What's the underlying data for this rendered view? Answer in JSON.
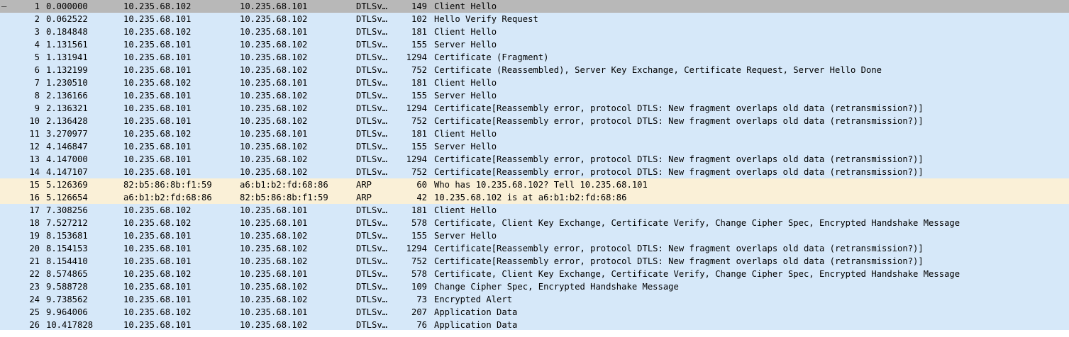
{
  "packets": [
    {
      "no": "1",
      "time": "0.000000",
      "src": "10.235.68.102",
      "dst": "10.235.68.101",
      "proto": "DTLSv…",
      "len": "149",
      "info": "Client Hello",
      "kind": "dtls",
      "selected": true,
      "marker": "–"
    },
    {
      "no": "2",
      "time": "0.062522",
      "src": "10.235.68.101",
      "dst": "10.235.68.102",
      "proto": "DTLSv…",
      "len": "102",
      "info": "Hello Verify Request",
      "kind": "dtls"
    },
    {
      "no": "3",
      "time": "0.184848",
      "src": "10.235.68.102",
      "dst": "10.235.68.101",
      "proto": "DTLSv…",
      "len": "181",
      "info": "Client Hello",
      "kind": "dtls"
    },
    {
      "no": "4",
      "time": "1.131561",
      "src": "10.235.68.101",
      "dst": "10.235.68.102",
      "proto": "DTLSv…",
      "len": "155",
      "info": "Server Hello",
      "kind": "dtls"
    },
    {
      "no": "5",
      "time": "1.131941",
      "src": "10.235.68.101",
      "dst": "10.235.68.102",
      "proto": "DTLSv…",
      "len": "1294",
      "info": "Certificate (Fragment)",
      "kind": "dtls"
    },
    {
      "no": "6",
      "time": "1.132199",
      "src": "10.235.68.101",
      "dst": "10.235.68.102",
      "proto": "DTLSv…",
      "len": "752",
      "info": "Certificate (Reassembled), Server Key Exchange, Certificate Request, Server Hello Done",
      "kind": "dtls"
    },
    {
      "no": "7",
      "time": "1.230510",
      "src": "10.235.68.102",
      "dst": "10.235.68.101",
      "proto": "DTLSv…",
      "len": "181",
      "info": "Client Hello",
      "kind": "dtls"
    },
    {
      "no": "8",
      "time": "2.136166",
      "src": "10.235.68.101",
      "dst": "10.235.68.102",
      "proto": "DTLSv…",
      "len": "155",
      "info": "Server Hello",
      "kind": "dtls"
    },
    {
      "no": "9",
      "time": "2.136321",
      "src": "10.235.68.101",
      "dst": "10.235.68.102",
      "proto": "DTLSv…",
      "len": "1294",
      "info": "Certificate[Reassembly error, protocol DTLS: New fragment overlaps old data (retransmission?)]",
      "kind": "dtls"
    },
    {
      "no": "10",
      "time": "2.136428",
      "src": "10.235.68.101",
      "dst": "10.235.68.102",
      "proto": "DTLSv…",
      "len": "752",
      "info": "Certificate[Reassembly error, protocol DTLS: New fragment overlaps old data (retransmission?)]",
      "kind": "dtls"
    },
    {
      "no": "11",
      "time": "3.270977",
      "src": "10.235.68.102",
      "dst": "10.235.68.101",
      "proto": "DTLSv…",
      "len": "181",
      "info": "Client Hello",
      "kind": "dtls"
    },
    {
      "no": "12",
      "time": "4.146847",
      "src": "10.235.68.101",
      "dst": "10.235.68.102",
      "proto": "DTLSv…",
      "len": "155",
      "info": "Server Hello",
      "kind": "dtls"
    },
    {
      "no": "13",
      "time": "4.147000",
      "src": "10.235.68.101",
      "dst": "10.235.68.102",
      "proto": "DTLSv…",
      "len": "1294",
      "info": "Certificate[Reassembly error, protocol DTLS: New fragment overlaps old data (retransmission?)]",
      "kind": "dtls"
    },
    {
      "no": "14",
      "time": "4.147107",
      "src": "10.235.68.101",
      "dst": "10.235.68.102",
      "proto": "DTLSv…",
      "len": "752",
      "info": "Certificate[Reassembly error, protocol DTLS: New fragment overlaps old data (retransmission?)]",
      "kind": "dtls"
    },
    {
      "no": "15",
      "time": "5.126369",
      "src": "82:b5:86:8b:f1:59",
      "dst": "a6:b1:b2:fd:68:86",
      "proto": "ARP",
      "len": "60",
      "info": "Who has 10.235.68.102? Tell 10.235.68.101",
      "kind": "arp"
    },
    {
      "no": "16",
      "time": "5.126654",
      "src": "a6:b1:b2:fd:68:86",
      "dst": "82:b5:86:8b:f1:59",
      "proto": "ARP",
      "len": "42",
      "info": "10.235.68.102 is at a6:b1:b2:fd:68:86",
      "kind": "arp"
    },
    {
      "no": "17",
      "time": "7.308256",
      "src": "10.235.68.102",
      "dst": "10.235.68.101",
      "proto": "DTLSv…",
      "len": "181",
      "info": "Client Hello",
      "kind": "dtls"
    },
    {
      "no": "18",
      "time": "7.527212",
      "src": "10.235.68.102",
      "dst": "10.235.68.101",
      "proto": "DTLSv…",
      "len": "578",
      "info": "Certificate, Client Key Exchange, Certificate Verify, Change Cipher Spec, Encrypted Handshake Message",
      "kind": "dtls"
    },
    {
      "no": "19",
      "time": "8.153681",
      "src": "10.235.68.101",
      "dst": "10.235.68.102",
      "proto": "DTLSv…",
      "len": "155",
      "info": "Server Hello",
      "kind": "dtls"
    },
    {
      "no": "20",
      "time": "8.154153",
      "src": "10.235.68.101",
      "dst": "10.235.68.102",
      "proto": "DTLSv…",
      "len": "1294",
      "info": "Certificate[Reassembly error, protocol DTLS: New fragment overlaps old data (retransmission?)]",
      "kind": "dtls"
    },
    {
      "no": "21",
      "time": "8.154410",
      "src": "10.235.68.101",
      "dst": "10.235.68.102",
      "proto": "DTLSv…",
      "len": "752",
      "info": "Certificate[Reassembly error, protocol DTLS: New fragment overlaps old data (retransmission?)]",
      "kind": "dtls"
    },
    {
      "no": "22",
      "time": "8.574865",
      "src": "10.235.68.102",
      "dst": "10.235.68.101",
      "proto": "DTLSv…",
      "len": "578",
      "info": "Certificate, Client Key Exchange, Certificate Verify, Change Cipher Spec, Encrypted Handshake Message",
      "kind": "dtls"
    },
    {
      "no": "23",
      "time": "9.588728",
      "src": "10.235.68.101",
      "dst": "10.235.68.102",
      "proto": "DTLSv…",
      "len": "109",
      "info": "Change Cipher Spec, Encrypted Handshake Message",
      "kind": "dtls"
    },
    {
      "no": "24",
      "time": "9.738562",
      "src": "10.235.68.101",
      "dst": "10.235.68.102",
      "proto": "DTLSv…",
      "len": "73",
      "info": "Encrypted Alert",
      "kind": "dtls"
    },
    {
      "no": "25",
      "time": "9.964006",
      "src": "10.235.68.102",
      "dst": "10.235.68.101",
      "proto": "DTLSv…",
      "len": "207",
      "info": "Application Data",
      "kind": "dtls"
    },
    {
      "no": "26",
      "time": "10.417828",
      "src": "10.235.68.101",
      "dst": "10.235.68.102",
      "proto": "DTLSv…",
      "len": "76",
      "info": "Application Data",
      "kind": "dtls"
    }
  ],
  "colors": {
    "dtls_row": "#d6e8f9",
    "arp_row": "#faf0d7",
    "selected_row": "#b8b8b8"
  },
  "icons": {
    "conversation_marker": "conversation-start-marker-icon"
  }
}
